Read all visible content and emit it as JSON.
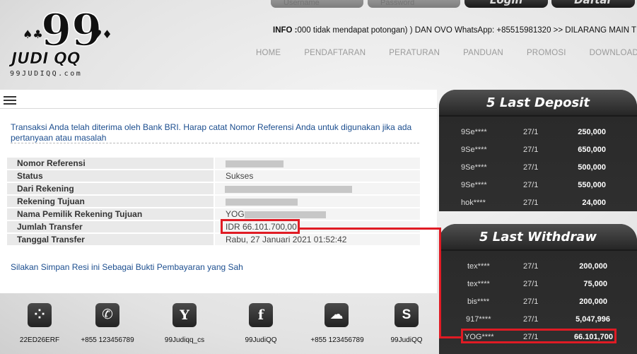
{
  "header": {
    "logo_text": "JUDI QQ",
    "logo_sub": "99JUDIQQ.com",
    "username_placeholder": "Username",
    "password_placeholder": "Password",
    "login_label": "Login",
    "register_label": "Daftar",
    "info_label": "INFO :",
    "info_text": "000 tidak mendapat potongan) ) DAN OVO WhatsApp: +85515981320 >> DILARANG MAIN T"
  },
  "nav": {
    "items": [
      "HOME",
      "PENDAFTARAN",
      "PERATURAN",
      "PANDUAN",
      "PROMOSI",
      "DOWNLOAD APK"
    ]
  },
  "main": {
    "notice": "Transaksi Anda telah diterima oleh Bank BRI. Harap catat Nomor Referensi Anda untuk digunakan jika ada pertanyaan atau masalah",
    "rows": [
      {
        "key": "Nomor Referensi",
        "value": ""
      },
      {
        "key": "Status",
        "value": "Sukses"
      },
      {
        "key": "Dari Rekening",
        "value": ""
      },
      {
        "key": "Rekening Tujuan",
        "value": ""
      },
      {
        "key": "Nama Pemilik Rekening Tujuan",
        "value": "YOG"
      },
      {
        "key": "Jumlah Transfer",
        "value": "IDR 66.101.700,00"
      },
      {
        "key": "Tanggal Transfer",
        "value": "Rabu, 27 Januari 2021 01:52:42"
      }
    ],
    "save_note": "Silakan Simpan Resi ini Sebagai Bukti Pembayaran yang Sah"
  },
  "deposit": {
    "title": "5 Last Deposit",
    "rows": [
      {
        "user": "9Se****",
        "date": "27/1",
        "amount": "250,000"
      },
      {
        "user": "9Se****",
        "date": "27/1",
        "amount": "650,000"
      },
      {
        "user": "9Se****",
        "date": "27/1",
        "amount": "500,000"
      },
      {
        "user": "9Se****",
        "date": "27/1",
        "amount": "550,000"
      },
      {
        "user": "hok****",
        "date": "27/1",
        "amount": "24,000"
      }
    ]
  },
  "withdraw": {
    "title": "5 Last Withdraw",
    "rows": [
      {
        "user": "tex****",
        "date": "27/1",
        "amount": "200,000"
      },
      {
        "user": "tex****",
        "date": "27/1",
        "amount": "75,000"
      },
      {
        "user": "bis****",
        "date": "27/1",
        "amount": "200,000"
      },
      {
        "user": "917****",
        "date": "27/1",
        "amount": "5,047,996"
      },
      {
        "user": "YOG****",
        "date": "27/1",
        "amount": "66.101,700"
      }
    ]
  },
  "footer": {
    "contacts": [
      {
        "icon": "blackberry-icon",
        "label": "22ED26ERF"
      },
      {
        "icon": "phone-icon",
        "label": "+855 123456789"
      },
      {
        "icon": "yahoo-icon",
        "label": "99Judiqq_cs"
      },
      {
        "icon": "facebook-icon",
        "label": "99JudiQQ"
      },
      {
        "icon": "wechat-icon",
        "label": "+855 123456789"
      },
      {
        "icon": "skype-icon",
        "label": "99JudiQQ"
      }
    ]
  },
  "colors": {
    "accent_red": "#e01b24",
    "link_blue": "#1c4e8f",
    "sidebar_dark": "#2f2f2f"
  }
}
